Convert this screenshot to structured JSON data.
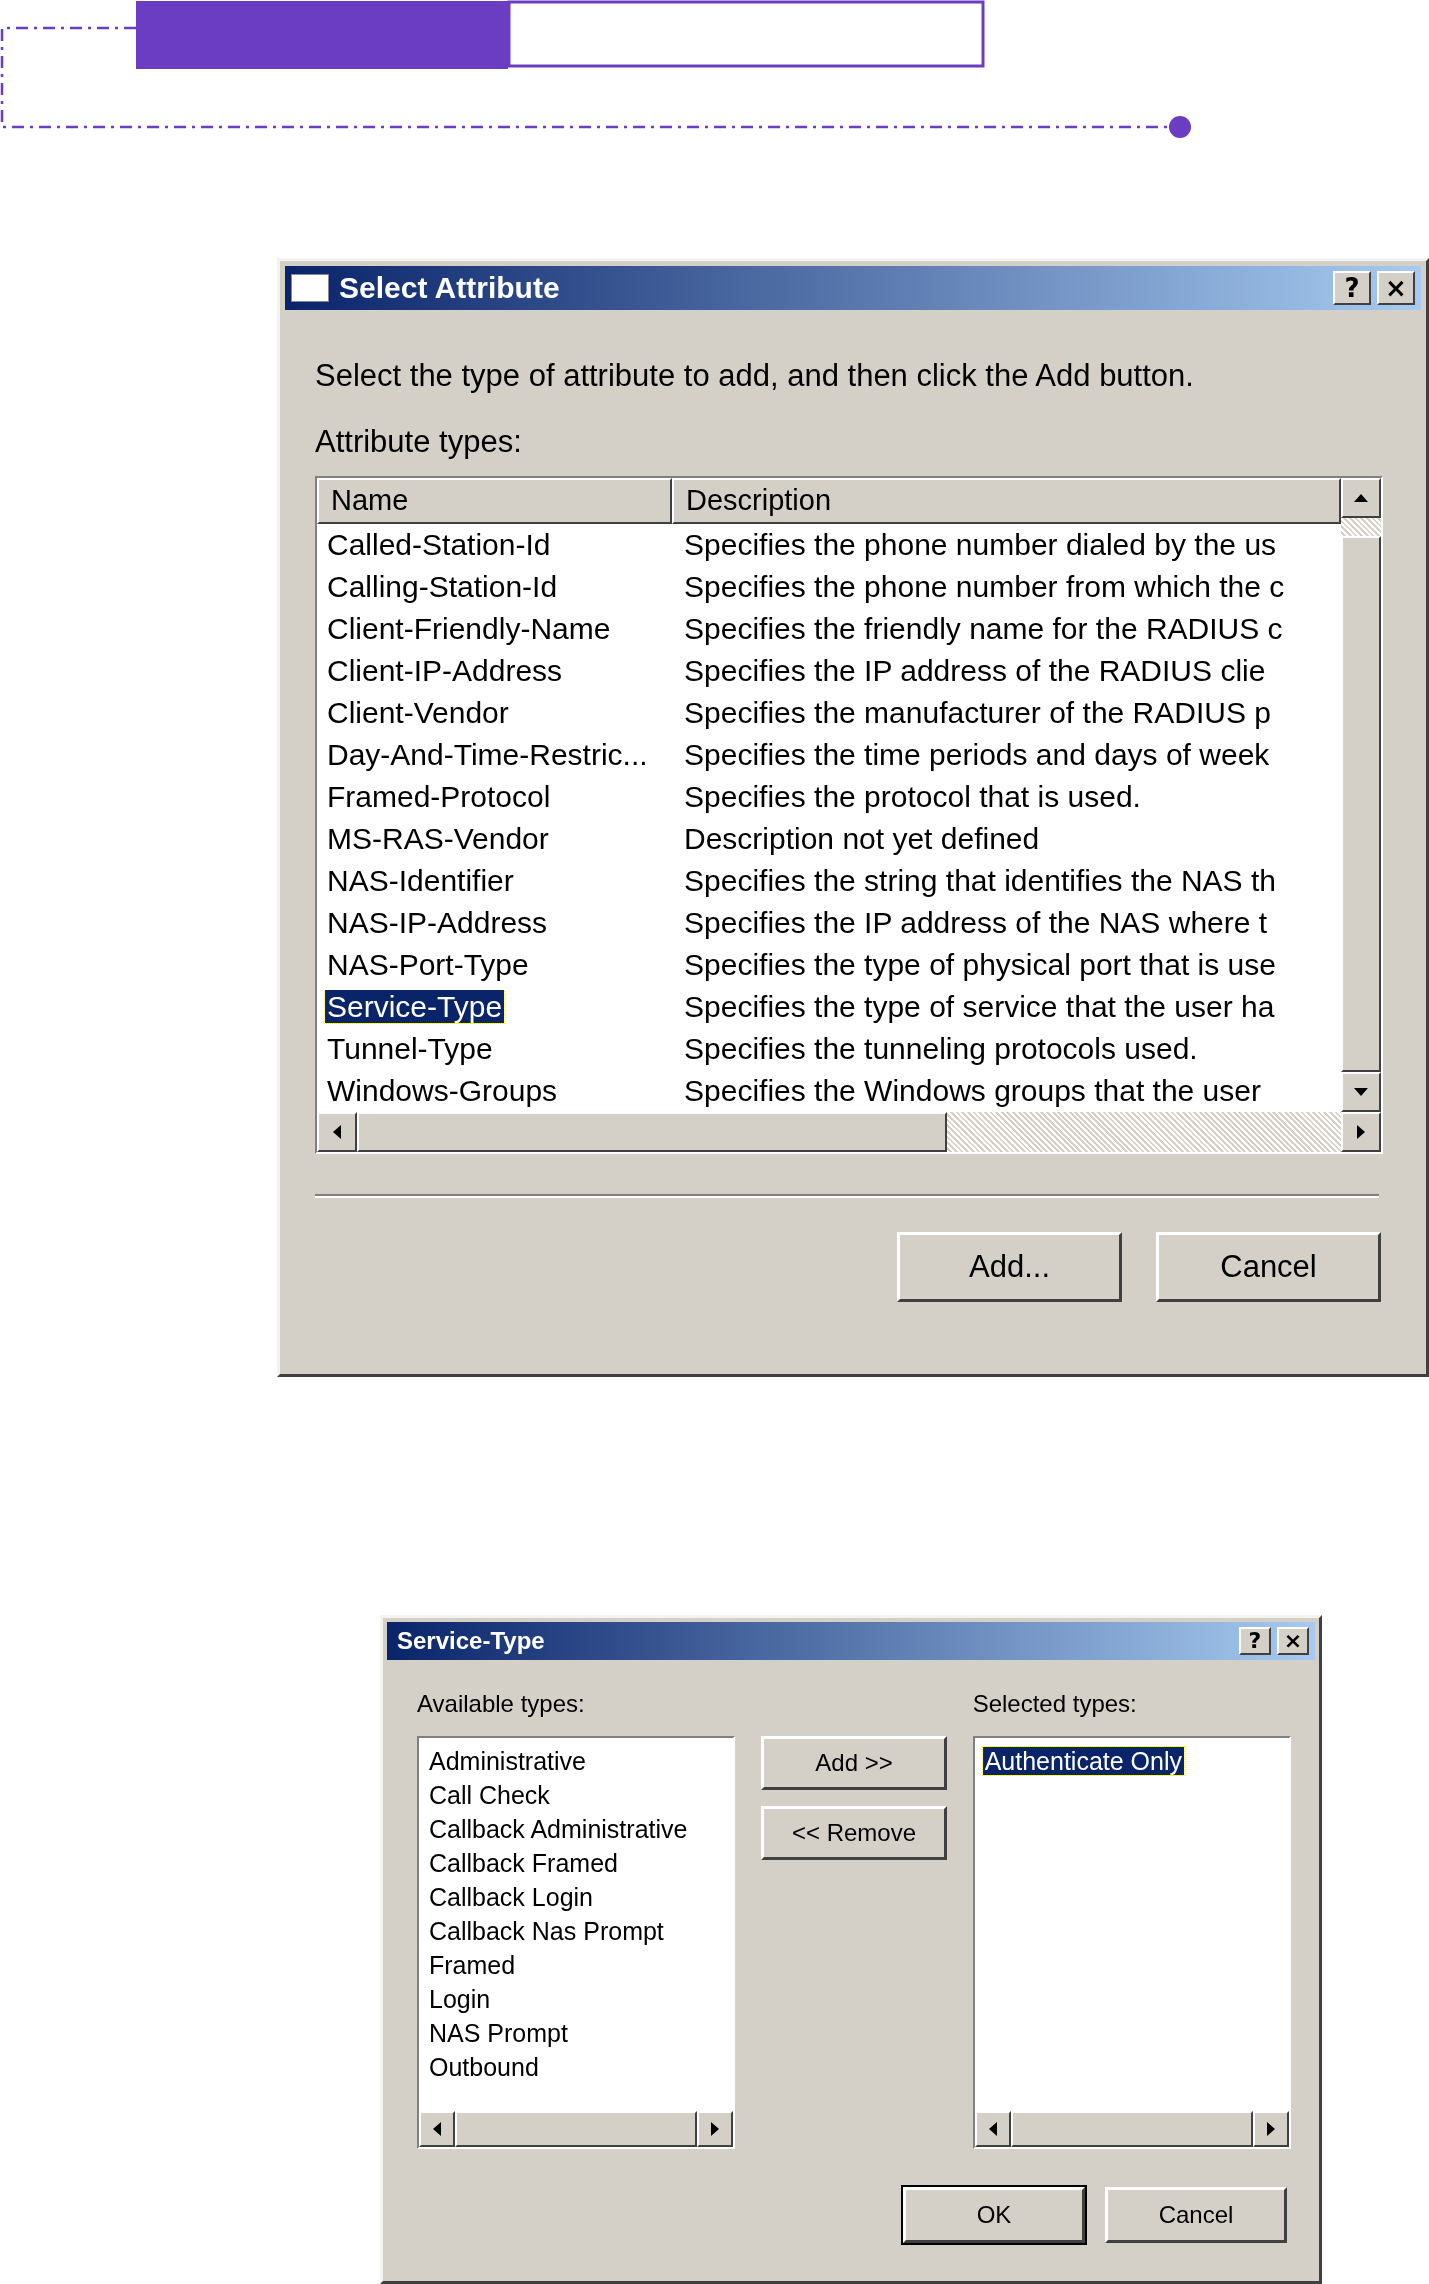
{
  "select_attribute": {
    "title": "Select Attribute",
    "help_glyph": "?",
    "close_glyph": "×",
    "instruction": "Select the type of attribute to add, and then click the Add button.",
    "list_label": "Attribute types:",
    "columns": [
      "Name",
      "Description"
    ],
    "rows": [
      {
        "name": "Called-Station-Id",
        "description": "Specifies the phone number dialed by the us",
        "selected": false
      },
      {
        "name": "Calling-Station-Id",
        "description": "Specifies the phone number from which the c",
        "selected": false
      },
      {
        "name": "Client-Friendly-Name",
        "description": "Specifies the friendly name for the RADIUS c",
        "selected": false
      },
      {
        "name": "Client-IP-Address",
        "description": "Specifies the IP address of the RADIUS clie",
        "selected": false
      },
      {
        "name": "Client-Vendor",
        "description": "Specifies the manufacturer of the RADIUS p",
        "selected": false
      },
      {
        "name": "Day-And-Time-Restric...",
        "description": "Specifies the time periods and days of week",
        "selected": false
      },
      {
        "name": "Framed-Protocol",
        "description": "Specifies the protocol that is used.",
        "selected": false
      },
      {
        "name": "MS-RAS-Vendor",
        "description": "Description not yet defined",
        "selected": false
      },
      {
        "name": "NAS-Identifier",
        "description": "Specifies the string that identifies the NAS th",
        "selected": false
      },
      {
        "name": "NAS-IP-Address",
        "description": "Specifies the IP address of the NAS where t",
        "selected": false
      },
      {
        "name": "NAS-Port-Type",
        "description": "Specifies the type of physical port that is use",
        "selected": false
      },
      {
        "name": "Service-Type",
        "description": "Specifies the type of service that the user ha",
        "selected": true
      },
      {
        "name": "Tunnel-Type",
        "description": "Specifies the tunneling protocols used.",
        "selected": false
      },
      {
        "name": "Windows-Groups",
        "description": "Specifies the Windows groups that the user",
        "selected": false
      }
    ],
    "buttons": [
      "Add...",
      "Cancel"
    ]
  },
  "service_type": {
    "title": "Service-Type",
    "help_glyph": "?",
    "close_glyph": "×",
    "available_label": "Available types:",
    "available": [
      {
        "label": "Administrative",
        "selected": false
      },
      {
        "label": "Call Check",
        "selected": false
      },
      {
        "label": "Callback Administrative",
        "selected": false
      },
      {
        "label": "Callback Framed",
        "selected": false
      },
      {
        "label": "Callback Login",
        "selected": false
      },
      {
        "label": "Callback Nas Prompt",
        "selected": false
      },
      {
        "label": "Framed",
        "selected": false
      },
      {
        "label": "Login",
        "selected": false
      },
      {
        "label": "NAS Prompt",
        "selected": false
      },
      {
        "label": "Outbound",
        "selected": false
      }
    ],
    "add_button": "Add >>",
    "remove_button": "<< Remove",
    "selected_label": "Selected types:",
    "selected_types": [
      {
        "label": "Authenticate Only",
        "selected": true
      }
    ],
    "buttons": [
      "OK",
      "Cancel"
    ]
  }
}
